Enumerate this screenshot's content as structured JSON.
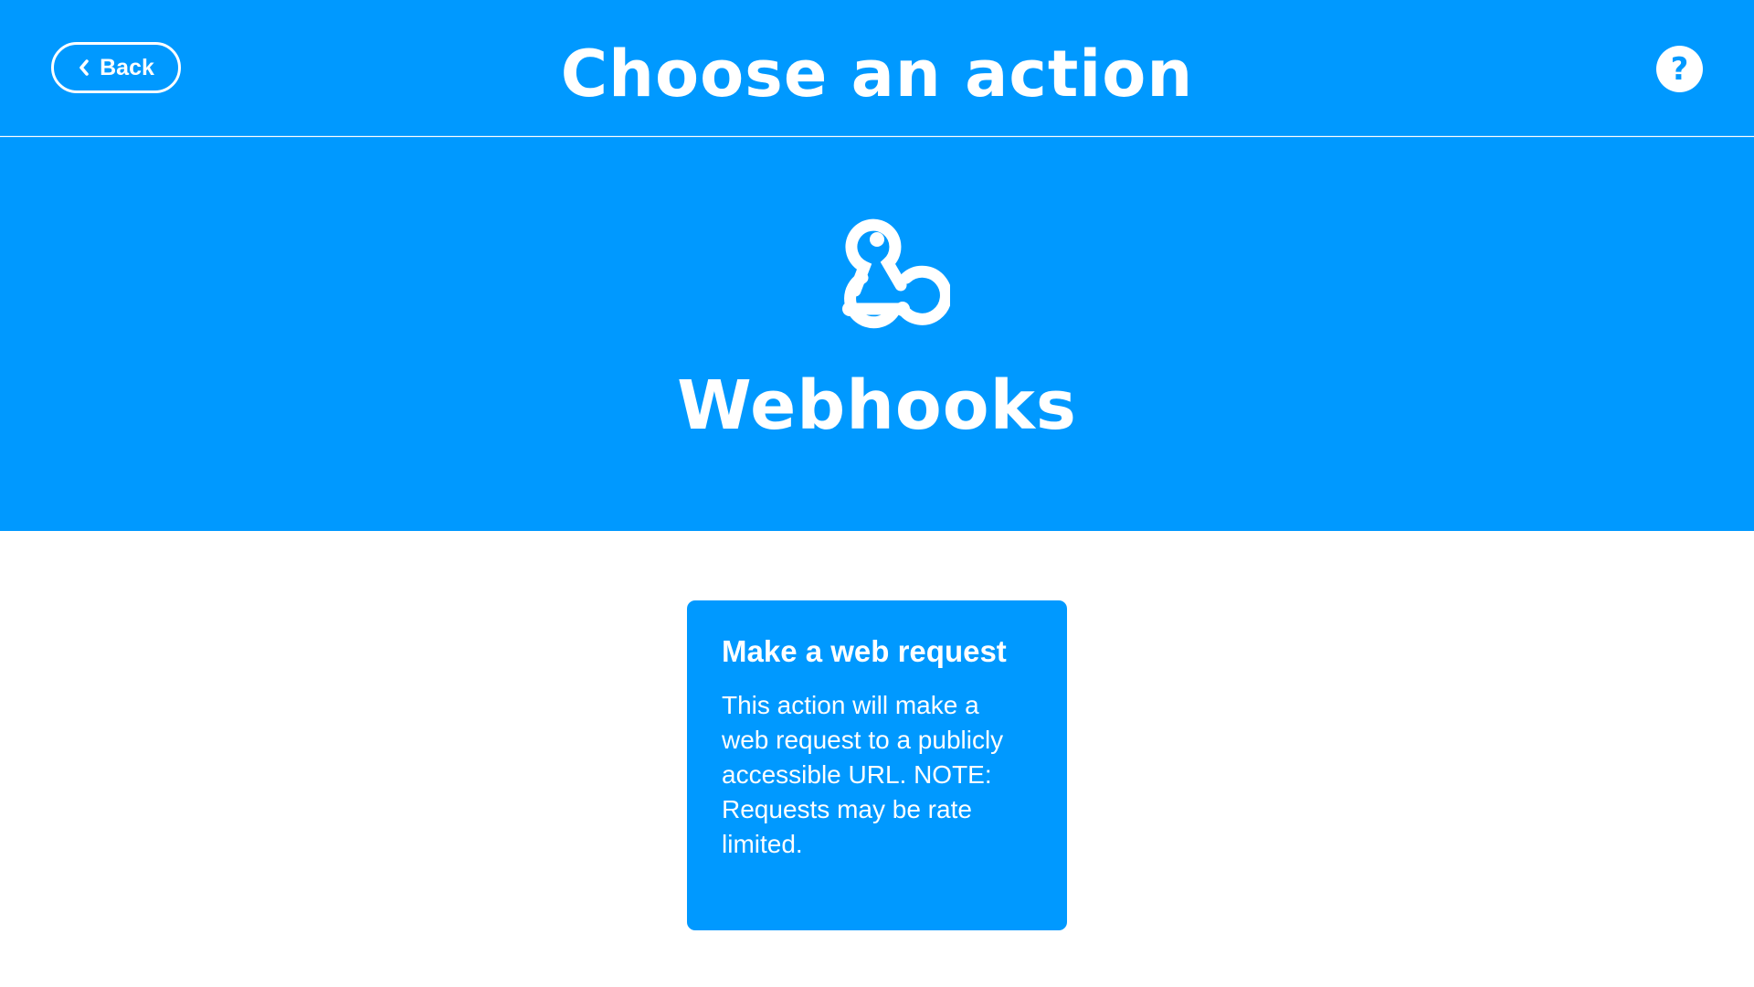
{
  "colors": {
    "brand_blue": "#0099ff",
    "text_on_brand": "#ffffff",
    "page_background": "#ffffff"
  },
  "header": {
    "back_label": "Back",
    "back_icon": "chevron-left-icon",
    "title": "Choose an action",
    "help_label": "?",
    "help_icon": "help-icon"
  },
  "service": {
    "name": "Webhooks",
    "icon": "webhooks-icon"
  },
  "actions": [
    {
      "title": "Make a web request",
      "description": "This action will make a web request to a publicly accessible URL. NOTE: Requests may be rate limited."
    }
  ]
}
